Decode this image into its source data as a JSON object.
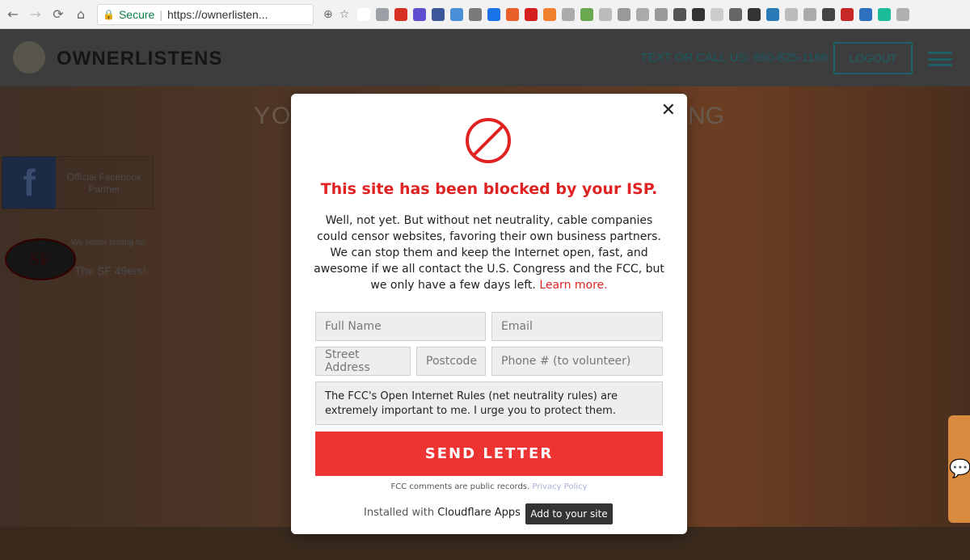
{
  "browser": {
    "secure_label": "Secure",
    "url": "https://ownerlisten...",
    "nav": {
      "back_icon": "←",
      "forward_icon": "→",
      "reload_icon": "⟳",
      "home_icon": "⌂"
    },
    "extensions": [
      {
        "name": "f?",
        "color": "#ffffff"
      },
      {
        "name": "abp",
        "color": "#9aa0a6"
      },
      {
        "name": "gmail",
        "color": "#d93025"
      },
      {
        "name": "y",
        "color": "#5f4fd0"
      },
      {
        "name": "facebook",
        "color": "#3b5998"
      },
      {
        "name": "sync",
        "color": "#4a90d9"
      },
      {
        "name": "pen",
        "color": "#7a7a7a"
      },
      {
        "name": "iq",
        "color": "#1a73e8"
      },
      {
        "name": "plus",
        "color": "#e8602a"
      },
      {
        "name": "red-circle",
        "color": "#d62020"
      },
      {
        "name": "orange",
        "color": "#f08030"
      },
      {
        "name": "gray1",
        "color": "#aaaaaa"
      },
      {
        "name": "rainbow",
        "color": "#6aa84f"
      },
      {
        "name": "gray2",
        "color": "#bbbbbb"
      },
      {
        "name": "g",
        "color": "#999999"
      },
      {
        "name": "gray3",
        "color": "#aaaaaa"
      },
      {
        "name": "gray4",
        "color": "#999999"
      },
      {
        "name": "note",
        "color": "#555555"
      },
      {
        "name": "meter",
        "color": "#333333"
      },
      {
        "name": "gray5",
        "color": "#cccccc"
      },
      {
        "name": "face",
        "color": "#666666"
      },
      {
        "name": "wolf",
        "color": "#333333"
      },
      {
        "name": "a",
        "color": "#2a7ab8"
      },
      {
        "name": "gray6",
        "color": "#bbbbbb"
      },
      {
        "name": "gray7",
        "color": "#aaaaaa"
      },
      {
        "name": "down",
        "color": "#444444"
      },
      {
        "name": "f-red",
        "color": "#c62828"
      },
      {
        "name": "cloud",
        "color": "#2f6fbf"
      },
      {
        "name": "f-green",
        "color": "#1abc9c"
      },
      {
        "name": "s",
        "color": "#b0b0b0"
      }
    ]
  },
  "site": {
    "logo_text": "OWNERLISTENS",
    "phone_text": "TEXT OR CALL US: 650-825-1166",
    "logout_label": "LOGOUT",
    "hero_title_left": "YO",
    "hero_title_right": "NG",
    "facebook_partner": {
      "icon_letter": "f",
      "text": "Official Facebook Partner"
    },
    "sf49": {
      "label": "We power texting for",
      "name": "The SF 49ers!",
      "logo_letters": "SF"
    },
    "chat_icon": "💬"
  },
  "modal": {
    "close_label": "✕",
    "title": "This site has been blocked by your ISP.",
    "body": "Well, not yet. But without net neutrality, cable companies could censor websites, favoring their own business partners. We can stop them and keep the Internet open, fast, and awesome if we all contact the U.S. Congress and the FCC, but we only have a few days left.",
    "learn_more": "Learn more.",
    "fields": {
      "full_name": "Full Name",
      "email": "Email",
      "street": "Street Address",
      "postcode": "Postcode",
      "phone": "Phone # (to volunteer)"
    },
    "letter_text": "The FCC's Open Internet Rules (net neutrality rules) are extremely important to me. I urge you to protect them.",
    "send_label": "SEND LETTER",
    "public_note": "FCC comments are public records.",
    "privacy_label": "Privacy Policy",
    "installed_prefix": "Installed with",
    "installed_brand": "Cloudflare Apps",
    "add_site_label": "Add to your site"
  }
}
